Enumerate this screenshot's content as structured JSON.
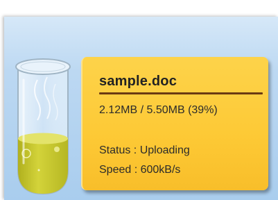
{
  "file": {
    "name": "sample.doc",
    "progress_text": "2.12MB / 5.50MB (39%)",
    "uploaded_mb": 2.12,
    "total_mb": 5.5,
    "percent": 39
  },
  "status": {
    "label": "Status : Uploading"
  },
  "speed": {
    "label": "Speed : 600kB/s"
  },
  "colors": {
    "card": "#fdca37",
    "rule": "#6b3a12",
    "liquid": "#c8c82e",
    "background": "#b7d6f1"
  },
  "icons": {
    "indicator": "test-tube-icon"
  }
}
